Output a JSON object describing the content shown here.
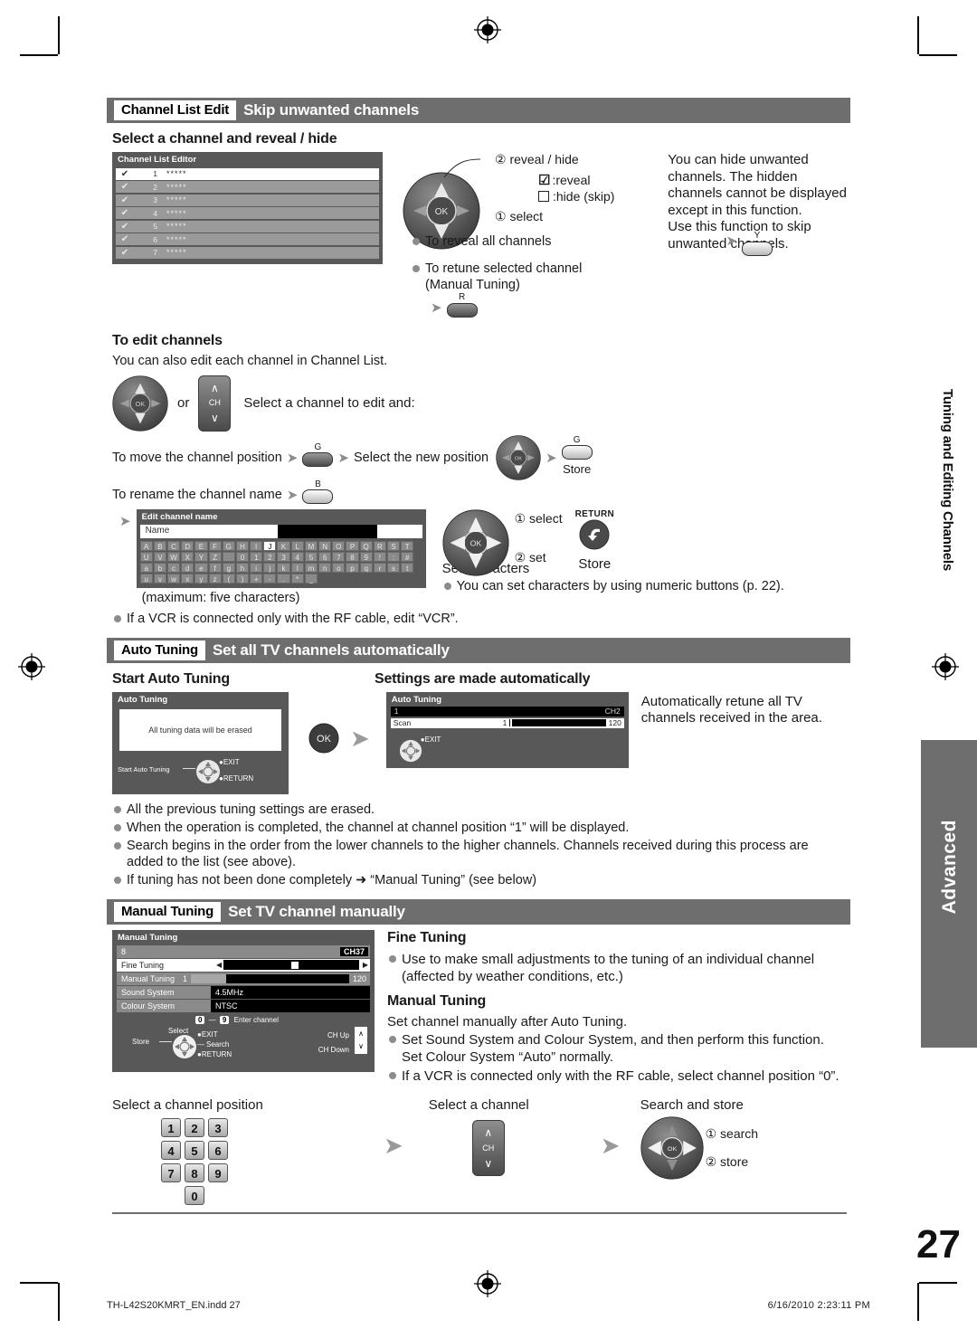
{
  "page": {
    "number": "27",
    "side_tab_label": "Tuning and Editing Channels",
    "advanced_tab_label": "Advanced"
  },
  "footer": {
    "file": "TH-L42S20KMRT_EN.indd   27",
    "timestamp": "6/16/2010   2:23:11 PM"
  },
  "section_channel_list": {
    "tag": "Channel List Edit",
    "title": "Skip unwanted channels",
    "sub_heading": "Select a channel and reveal / hide",
    "osd": {
      "title": "Channel List Editor",
      "rows": [
        {
          "check": "✔",
          "no": "1",
          "stars": "*****"
        },
        {
          "check": "✔",
          "no": "2",
          "stars": "*****"
        },
        {
          "check": "✔",
          "no": "3",
          "stars": "*****"
        },
        {
          "check": "✔",
          "no": "4",
          "stars": "*****"
        },
        {
          "check": "✔",
          "no": "5",
          "stars": "*****"
        },
        {
          "check": "✔",
          "no": "6",
          "stars": "*****"
        },
        {
          "check": "✔",
          "no": "7",
          "stars": "*****"
        }
      ]
    },
    "callout_1": "① select",
    "callout_2": "② reveal / hide",
    "legend_reveal": ":reveal",
    "legend_hide": ":hide (skip)",
    "bullet_reveal_all": "To reveal all channels",
    "key_y": "Y",
    "bullet_retune_1": "To retune selected channel",
    "bullet_retune_2": "(Manual Tuning)",
    "key_r": "R",
    "note": "You can hide unwanted channels. The hidden channels cannot be displayed except in this function.\nUse this function to skip unwanted channels."
  },
  "section_edit_channels": {
    "heading": "To edit channels",
    "intro": "You can also edit each channel in Channel List.",
    "or_word": "or",
    "ch_key_label": "CH",
    "select_line": "Select a channel to edit and:",
    "bullet_move": "To move the channel position",
    "key_g": "G",
    "select_new_position": "Select the new position",
    "key_g2": "G",
    "store_label": "Store",
    "bullet_rename": "To rename the channel name",
    "key_b": "B",
    "osd": {
      "title": "Edit channel name",
      "name_label": "Name",
      "rows": [
        [
          "A",
          "B",
          "C",
          "D",
          "E",
          "F",
          "G",
          "H",
          "I",
          "J",
          "K",
          "L",
          "M",
          "N",
          "O",
          "P",
          "Q",
          "R",
          "S",
          "T"
        ],
        [
          "U",
          "V",
          "W",
          "X",
          "Y",
          "Z",
          " ",
          "0",
          "1",
          "2",
          "3",
          "4",
          "5",
          "6",
          "7",
          "8",
          "9",
          "!",
          ":",
          "#"
        ],
        [
          "a",
          "b",
          "c",
          "d",
          "e",
          "f",
          "g",
          "h",
          "i",
          "j",
          "k",
          "l",
          "m",
          "n",
          "o",
          "p",
          "q",
          "r",
          "s",
          "t"
        ],
        [
          "u",
          "v",
          "w",
          "x",
          "y",
          "z",
          "(",
          ")",
          "+",
          "-",
          ".",
          "*",
          "_",
          "",
          "",
          "",
          "",
          "",
          "",
          ""
        ]
      ],
      "selected_key": "J"
    },
    "maximum_note": "(maximum: five characters)",
    "callout_select": "① select",
    "callout_set": "② set",
    "set_characters": "Set characters",
    "return_label": "RETURN",
    "store_label2": "Store",
    "numeric_note": "You can set characters by using numeric buttons (p. 22).",
    "vcr_note": "If a VCR is connected only with the RF cable, edit “VCR”."
  },
  "section_auto_tuning": {
    "tag": "Auto Tuning",
    "title": "Set all TV channels automatically",
    "left_heading": "Start Auto Tuning",
    "right_heading": "Settings are made automatically",
    "osd_start": {
      "title": "Auto Tuning",
      "message": "All tuning data will be erased",
      "hint_label": "Start Auto Tuning",
      "exit": "EXIT",
      "return": "RETURN"
    },
    "ok_key": "OK",
    "osd_scan": {
      "title": "Auto Tuning",
      "position": "1",
      "channel": "CH2",
      "scan_label": "Scan",
      "scan_min": "1",
      "scan_max": "120",
      "exit": "EXIT"
    },
    "description": "Automatically retune all TV channels received in the area.",
    "bullets": [
      "All the previous tuning settings are erased.",
      "When the operation is completed, the channel at channel position “1” will be displayed.",
      "Search begins in the order from the lower channels to the higher channels. Channels received during this process are added to the list (see above).",
      "If tuning has not been done completely ➜ “Manual Tuning” (see below)"
    ]
  },
  "section_manual_tuning": {
    "tag": "Manual Tuning",
    "title": "Set TV channel manually",
    "osd": {
      "title": "Manual Tuning",
      "position": "8",
      "channel": "CH37",
      "fine_tuning_label": "Fine Tuning",
      "manual_tuning_label": "Manual Tuning",
      "manual_min": "1",
      "manual_max": "120",
      "sound_system_label": "Sound System",
      "sound_system_value": "4.5MHz",
      "colour_system_label": "Colour System",
      "colour_system_value": "NTSC",
      "hint_select": "Select",
      "hint_store": "Store",
      "hint_key_0": "0",
      "hint_dash": "—",
      "hint_key_9": "9",
      "hint_enter_channel": "Enter channel",
      "hint_exit": "EXIT",
      "hint_search": "Search",
      "hint_return": "RETURN",
      "hint_ch_up": "CH Up",
      "hint_ch_down": "CH Down"
    },
    "fine_heading": "Fine Tuning",
    "fine_bullet": "Use to make small adjustments to the tuning of an individual channel (affected by weather conditions, etc.)",
    "manual_heading": "Manual Tuning",
    "manual_text": "Set channel manually after Auto Tuning.",
    "manual_bullets": [
      "Set Sound System and Colour System, and then perform this function. Set Colour System “Auto” normally.",
      "If a VCR is connected only with the RF cable, select channel position “0”."
    ],
    "steps": {
      "step1_label": "Select a channel position",
      "keys": [
        "1",
        "2",
        "3",
        "4",
        "5",
        "6",
        "7",
        "8",
        "9",
        "0"
      ],
      "step2_label": "Select a channel",
      "ch_key": "CH",
      "step3_label": "Search and store",
      "callout_search": "① search",
      "callout_store": "② store"
    }
  }
}
